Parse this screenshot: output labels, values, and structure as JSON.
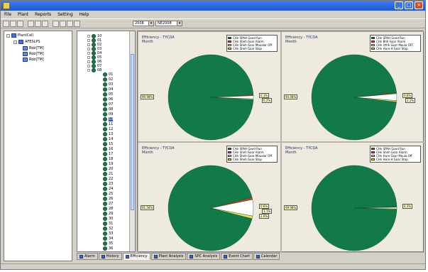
{
  "window": {
    "title": "",
    "controls": [
      "_",
      "□",
      "×"
    ]
  },
  "menu": [
    "File",
    "Plant",
    "Reports",
    "Setting",
    "Help"
  ],
  "toolbar": {
    "date_value": "2008",
    "shift_value": "NE2008"
  },
  "tree": {
    "root": "PlantCell",
    "child": "AFESLPS",
    "leaves": [
      "Rob[TM]",
      "Rob[TM]",
      "Rob[TM]"
    ]
  },
  "devices": {
    "top_items": [
      "10",
      "01",
      "02",
      "03",
      "04",
      "05",
      "06",
      "07",
      "08"
    ],
    "list_items": [
      "01",
      "02",
      "03",
      "04",
      "05",
      "06",
      "07",
      "08",
      "09",
      "10",
      "11",
      "12",
      "13",
      "14",
      "15",
      "16",
      "17",
      "18",
      "19",
      "20",
      "21",
      "22",
      "23",
      "24",
      "25",
      "26",
      "27",
      "28",
      "29",
      "30",
      "31",
      "32",
      "33",
      "34",
      "35",
      "36"
    ],
    "selected_index": 9
  },
  "charts": [
    {
      "title": "Efficiency - TYCDA",
      "subtitle": "Month",
      "legend": [
        "CHn SPAH Good Run",
        "CHn Sheh Goar Alarm",
        "CHn Sheh Goar Moualar Off",
        "CHn Sheh Goar Stop"
      ],
      "slices": [
        0.982,
        0.003,
        0.012,
        0.003
      ],
      "callouts": [
        "99.98%",
        "0.1%",
        "0.2%"
      ]
    },
    {
      "title": "Efficiency - TYCDA",
      "subtitle": "Month",
      "legend": [
        "CHn SPAH Good Run",
        "CHn Bhh Goar Alarm",
        "CHn Uthh Goar Moula OFF",
        "CHn Hure H Goar Stop"
      ],
      "slices": [
        0.965,
        0.004,
        0.026,
        0.005
      ],
      "callouts": [
        "94.48%",
        "0.6%",
        "2.1%"
      ]
    },
    {
      "title": "Efficiency - TYCDA",
      "subtitle": "Month",
      "legend": [
        "CHn SPAH Good Run",
        "CHn Sheh Goar Alarm",
        "CHn Sheh Goar Moualar Off",
        "CHn Sheh Goar Stop"
      ],
      "slices": [
        0.92,
        0.008,
        0.062,
        0.01
      ],
      "callouts": [
        "91.56%",
        "0.6%",
        "1.1%",
        "2.6%"
      ]
    },
    {
      "title": "Efficiency - TYCDA",
      "subtitle": "Month",
      "legend": [
        "CHn SPAH Good Run",
        "CHn Sheh Goar Alarm",
        "CHn Hure Goar Moula Off",
        "CHn Hure H Goar Stop"
      ],
      "slices": [
        0.99,
        0.002,
        0.006,
        0.002
      ],
      "callouts": [
        "99.98%",
        "0.3%"
      ]
    }
  ],
  "colors": {
    "good_run": "#127a46",
    "alarm": "#d63a2a",
    "manual_off": "#ffffff",
    "stop": "#f0e060"
  },
  "tabs": [
    "Alarm",
    "History",
    "Efficiency",
    "Plant Analysis",
    "SPC Analysis",
    "Event Chart",
    "Calendar"
  ],
  "active_tab": 2
}
